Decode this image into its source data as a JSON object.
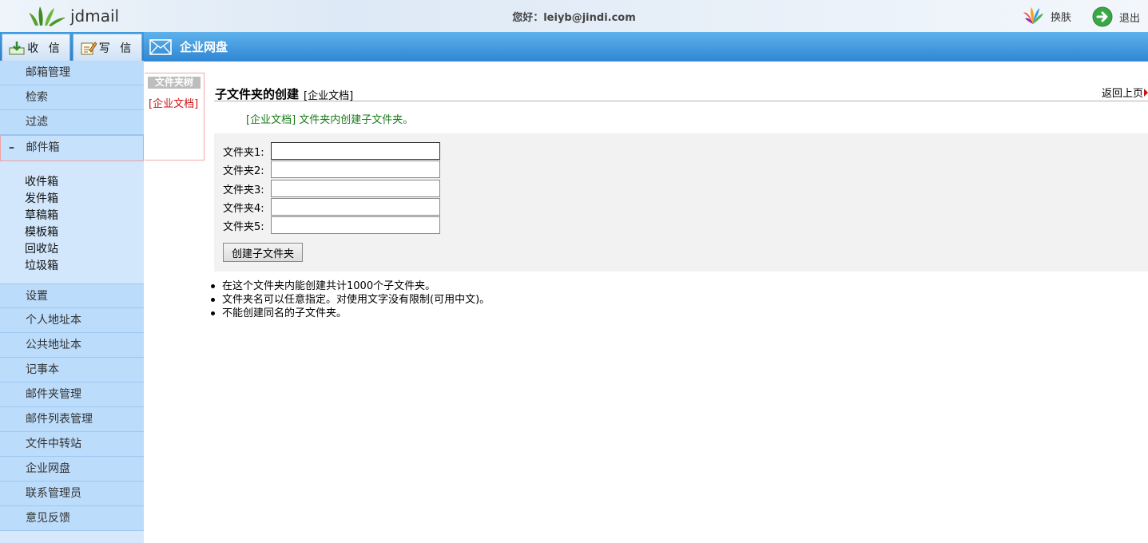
{
  "app": {
    "logo_text": "jdmail"
  },
  "header": {
    "greeting": "您好：leiyb@jindi.com",
    "skin_label": "换肤",
    "logout_label": "退出"
  },
  "sidebar": {
    "receive_label": "收 信",
    "compose_label": "写 信",
    "top_items": [
      "邮箱管理",
      "检索",
      "过滤"
    ],
    "mailbox_group": {
      "toggle": "–",
      "label": "邮件箱"
    },
    "mailbox_items": [
      "收件箱",
      "发件箱",
      "草稿箱",
      "模板箱",
      "回收站",
      "垃圾箱"
    ],
    "settings_label": "设置",
    "bottom_items": [
      "个人地址本",
      "公共地址本",
      "记事本",
      "邮件夹管理",
      "邮件列表管理",
      "文件中转站",
      "企业网盘",
      "联系管理员",
      "意见反馈"
    ]
  },
  "content_header": {
    "title": "企业网盘"
  },
  "folder_tree": {
    "title": "文件夹树",
    "item": "[企业文档]"
  },
  "main": {
    "heading": "子文件夹的创建",
    "heading_folder": "[企业文档]",
    "back_label": "返回上页",
    "info": "[企业文档] 文件夹内创建子文件夹。",
    "fields": [
      {
        "label": "文件夹1:",
        "value": ""
      },
      {
        "label": "文件夹2:",
        "value": ""
      },
      {
        "label": "文件夹3:",
        "value": ""
      },
      {
        "label": "文件夹4:",
        "value": ""
      },
      {
        "label": "文件夹5:",
        "value": ""
      }
    ],
    "create_button": "创建子文件夹",
    "notes": [
      "在这个文件夹内能创建共计1000个子文件夹。",
      "文件夹名可以任意指定。对使用文字没有限制(可用中文)。",
      "不能创建同名的子文件夹。"
    ]
  }
}
